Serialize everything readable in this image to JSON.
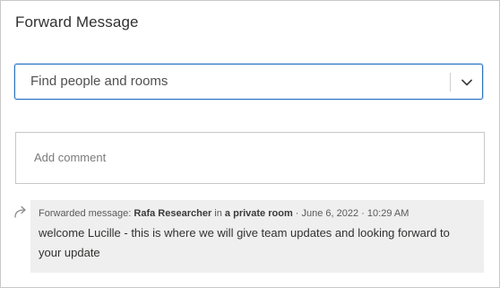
{
  "dialog": {
    "title": "Forward Message"
  },
  "picker": {
    "placeholder": "Find people and rooms",
    "caret_icon": "chevron-down-icon"
  },
  "comment": {
    "placeholder": "Add comment"
  },
  "forwarded": {
    "icon": "forward-arrow-icon",
    "prefix": "Forwarded message: ",
    "author": "Rafa Researcher",
    "in_text": " in ",
    "location": "a private room",
    "separator": " · ",
    "date": "June 6, 2022",
    "time": "10:29 AM",
    "body": "welcome Lucille - this is where we will give team updates and looking forward to your update"
  },
  "colors": {
    "accent_border": "#2b73c2",
    "quote_background": "#efefef"
  }
}
